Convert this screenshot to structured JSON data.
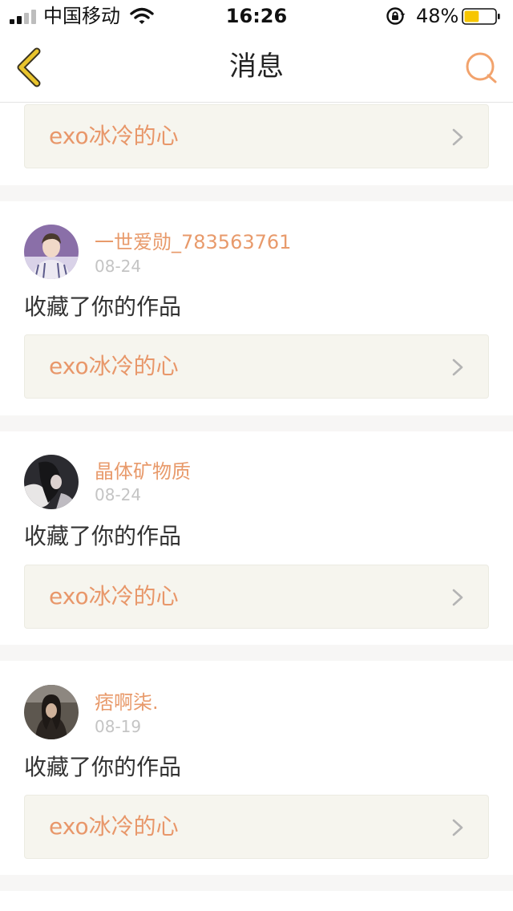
{
  "status_bar": {
    "carrier": "中国移动",
    "time": "16:26",
    "battery_percent": "48%",
    "battery_level": 0.48,
    "battery_color": "#f7c600"
  },
  "header": {
    "title": "消息",
    "back_icon": "chevron-left-icon",
    "search_icon": "search-icon",
    "accent_color": "#f2a36d",
    "back_color": "#e9c42c"
  },
  "messages": [
    {
      "work_title": "exo冰冷的心"
    },
    {
      "username": "一世爱勋_783563761",
      "date": "08-24",
      "action": "收藏了你的作品",
      "work_title": "exo冰冷的心"
    },
    {
      "username": "晶体矿物质",
      "date": "08-24",
      "action": "收藏了你的作品",
      "work_title": "exo冰冷的心"
    },
    {
      "username": "痞啊柒.",
      "date": "08-19",
      "action": "收藏了你的作品",
      "work_title": "exo冰冷的心"
    }
  ]
}
